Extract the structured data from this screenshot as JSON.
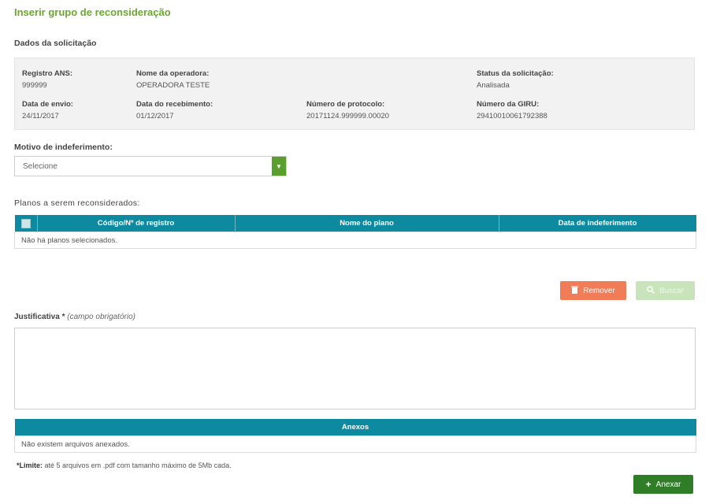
{
  "page": {
    "title": "Inserir grupo de reconsideração"
  },
  "request": {
    "section_title": "Dados da solicitação",
    "registro_label": "Registro ANS:",
    "registro_value": "999999",
    "operadora_label": "Nome da operadora:",
    "operadora_value": "OPERADORA TESTE",
    "status_label": "Status da solicitação:",
    "status_value": "Analisada",
    "envio_label": "Data de envio:",
    "envio_value": "24/11/2017",
    "recebimento_label": "Data do recebimento:",
    "recebimento_value": "01/12/2017",
    "protocolo_label": "Número de protocolo:",
    "protocolo_value": "20171124.999999.00020",
    "giru_label": "Número da GIRU:",
    "giru_value": "29410010061792388"
  },
  "motivo": {
    "label": "Motivo de indeferimento:",
    "selected": "Selecione"
  },
  "plans": {
    "section_title": "Planos a serem reconsiderados:",
    "columns": [
      "Código/Nº de registro",
      "Nome do plano",
      "Data de indeferimento"
    ],
    "empty_message": "Não há planos selecionados."
  },
  "actions": {
    "remove_label": "Remover",
    "search_label": "Buscar"
  },
  "justificativa": {
    "label": "Justificativa *",
    "note": "(campo obrigatório)"
  },
  "annexes": {
    "header": "Anexos",
    "empty_message": "Não existem arquivos anexados.",
    "limit_label": "*Limite:",
    "limit_text": "até 5 arquivos em .pdf com tamanho máximo de 5Mb cada.",
    "attach_label": "Anexar"
  },
  "colors": {
    "brand_green": "#6aa82f",
    "teal_header": "#0e8aa0",
    "danger": "#f07c58",
    "success_dark": "#2f7d26"
  }
}
